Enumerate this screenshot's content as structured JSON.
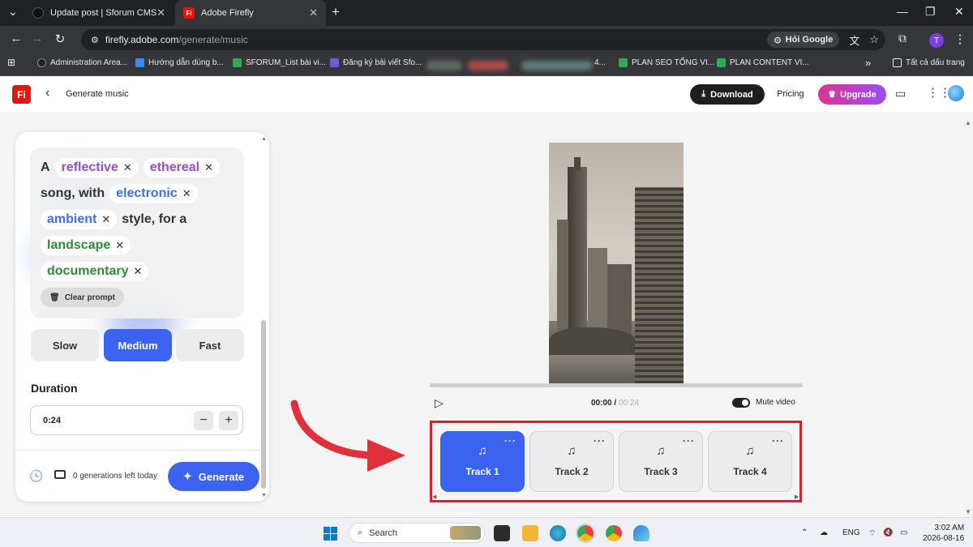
{
  "browser": {
    "tabs": [
      {
        "title": "Update post | Sforum CMS",
        "close": "✕"
      },
      {
        "title": "Adobe Firefly",
        "close": "✕"
      }
    ],
    "new_tab": "+",
    "window_controls": {
      "menu": "⌄",
      "minimize": "—",
      "restore": "❐",
      "close": "✕"
    },
    "url_host": "firefly.adobe.com",
    "url_path": "/generate/music",
    "hoi_google": "Hỏi Google",
    "profile_initial": "T",
    "bookmarks": [
      "Administration Area...",
      "Hướng dẫn dùng b...",
      "SFORUM_List bài vi...",
      "Đăng ký bài viết Sfo...",
      "PLAN SEO TỔNG VI...",
      "PLAN CONTENT VI..."
    ],
    "bookmark_blur_tail": "4...",
    "bookmarks_more": "»",
    "bookmarks_folder": "Tất cả dấu trang"
  },
  "header": {
    "logo": "Fi",
    "back": "‹",
    "title": "Generate music",
    "download": "Download",
    "pricing": "Pricing",
    "upgrade": "Upgrade"
  },
  "prompt": {
    "w_a": "A",
    "chip_reflective": "reflective",
    "chip_ethereal": "ethereal",
    "w_song_with": "song, with",
    "chip_electronic": "electronic",
    "chip_ambient": "ambient",
    "w_style_for_a": "style, for a",
    "chip_landscape": "landscape",
    "chip_documentary": "documentary",
    "remove": "✕",
    "clear": "Clear prompt"
  },
  "tempo": {
    "slow": "Slow",
    "medium": "Medium",
    "fast": "Fast",
    "selected": "Medium"
  },
  "duration": {
    "label": "Duration",
    "value": "0:24",
    "minus": "−",
    "plus": "+"
  },
  "footer": {
    "generations_left": "0 generations left today",
    "generate": "Generate"
  },
  "player": {
    "current_time": "00:00",
    "separator": " / ",
    "total_time": "00:24",
    "mute_label": "Mute video",
    "mute_on": true,
    "play": "▷",
    "progress": 0
  },
  "tracks": [
    {
      "label": "Track 1",
      "active": true
    },
    {
      "label": "Track 2",
      "active": false
    },
    {
      "label": "Track 3",
      "active": false
    },
    {
      "label": "Track 4",
      "active": false
    }
  ],
  "track_icon": "♫",
  "track_menu": "···",
  "taskbar": {
    "search": "Search",
    "lang": "ENG",
    "time": "3:02 AM",
    "date": "2026-08-16"
  },
  "colors": {
    "accent": "#3b63f0",
    "annotation_red": "#d71f2e",
    "firefly_red": "#e3150f"
  }
}
